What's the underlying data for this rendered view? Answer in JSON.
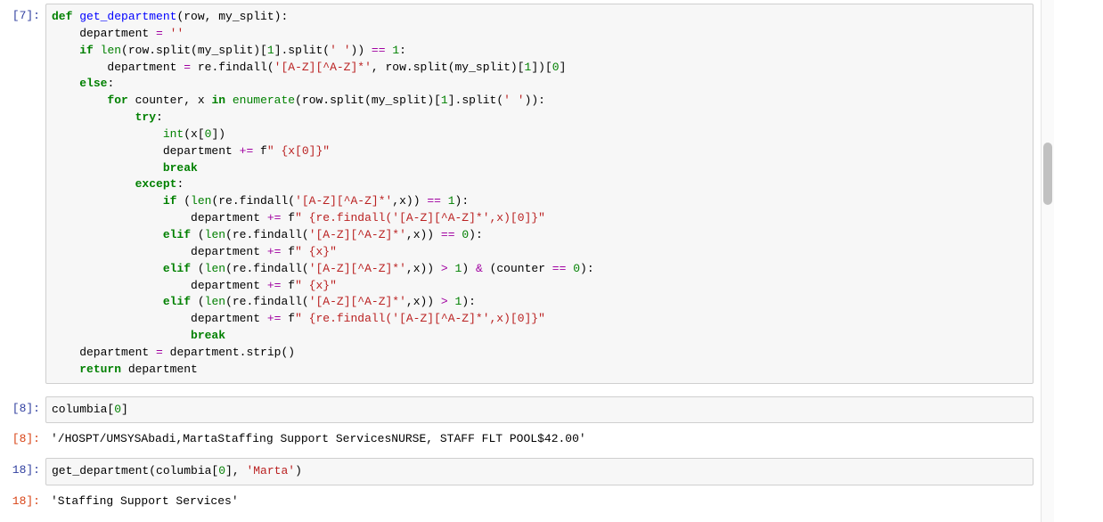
{
  "cells": [
    {
      "index": 0,
      "prompt_in": "[7]:",
      "prompt_out": "",
      "input_html": "<span class='kw'>def</span> <span class='fn'>get_department</span>(row, my_split):\n    department <span class='op'>=</span> <span class='str'>''</span>\n    <span class='kw'>if</span> <span class='bn'>len</span>(row.split(my_split)[<span class='num'>1</span>].split(<span class='str'>' '</span>)) <span class='op'>==</span> <span class='num'>1</span>:\n        department <span class='op'>=</span> re.findall(<span class='str'>'[A-Z][^A-Z]*'</span>, row.split(my_split)[<span class='num'>1</span>])[<span class='num'>0</span>]\n    <span class='kw'>else</span>:\n        <span class='kw'>for</span> counter, x <span class='kw'>in</span> <span class='bn'>enumerate</span>(row.split(my_split)[<span class='num'>1</span>].split(<span class='str'>' '</span>)):\n            <span class='kw'>try</span>:\n                <span class='bn'>int</span>(x[<span class='num'>0</span>])\n                department <span class='op'>+=</span> f<span class='str'>\" {x[0]}\"</span>\n                <span class='kw'>break</span>\n            <span class='kw'>except</span>:\n                <span class='kw'>if</span> (<span class='bn'>len</span>(re.findall(<span class='str'>'[A-Z][^A-Z]*'</span>,x)) <span class='op'>==</span> <span class='num'>1</span>):\n                    department <span class='op'>+=</span> f<span class='str'>\" {re.findall('[A-Z][^A-Z]*',x)[0]}\"</span>\n                <span class='kw'>elif</span> (<span class='bn'>len</span>(re.findall(<span class='str'>'[A-Z][^A-Z]*'</span>,x)) <span class='op'>==</span> <span class='num'>0</span>):\n                    department <span class='op'>+=</span> f<span class='str'>\" {x}\"</span>\n                <span class='kw'>elif</span> (<span class='bn'>len</span>(re.findall(<span class='str'>'[A-Z][^A-Z]*'</span>,x)) <span class='op'>&gt;</span> <span class='num'>1</span>) <span class='op'>&amp;</span> (counter <span class='op'>==</span> <span class='num'>0</span>):\n                    department <span class='op'>+=</span> f<span class='str'>\" {x}\"</span>\n                <span class='kw'>elif</span> (<span class='bn'>len</span>(re.findall(<span class='str'>'[A-Z][^A-Z]*'</span>,x)) <span class='op'>&gt;</span> <span class='num'>1</span>):\n                    department <span class='op'>+=</span> f<span class='str'>\" {re.findall('[A-Z][^A-Z]*',x)[0]}\"</span>\n                    <span class='kw'>break</span>\n    department <span class='op'>=</span> department.strip()\n    <span class='kw'>return</span> department",
      "output": ""
    },
    {
      "index": 1,
      "prompt_in": "[8]:",
      "prompt_out": "[8]:",
      "input_html": "columbia[<span class='num'>0</span>]",
      "output": "'/HOSPT/UMSYSAbadi,MartaStaffing Support ServicesNURSE, STAFF FLT POOL$42.00'"
    },
    {
      "index": 2,
      "prompt_in": "18]:",
      "prompt_out": "18]:",
      "input_html": "get_department(columbia[<span class='num'>0</span>], <span class='str'>'Marta'</span>)",
      "output": "'Staffing Support Services'"
    }
  ]
}
